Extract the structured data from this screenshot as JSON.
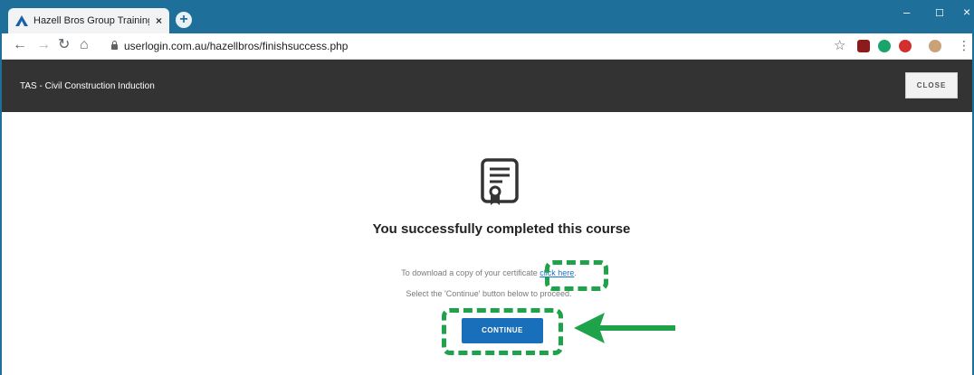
{
  "browser": {
    "tab_title": "Hazell Bros Group Training Platfo",
    "tab_close": "×",
    "new_tab": "+",
    "url": "userlogin.com.au/hazellbros/finishsuccess.php",
    "window_controls": {
      "minimize": "–",
      "maximize": "☐",
      "close": "×"
    },
    "colors": {
      "frame": "#1e6f9a"
    }
  },
  "app": {
    "course_title": "TAS - Civil Construction Induction",
    "close_label": "CLOSE"
  },
  "completion": {
    "heading": "You successfully completed this course",
    "download_prefix": "To download a copy of your certificate ",
    "download_link": "click here",
    "download_suffix": ".",
    "proceed_text": "Select the 'Continue' button below to proceed.",
    "continue_label": "CONTINUE",
    "icon": "certificate-icon"
  },
  "annotations": {
    "highlight_color": "#1fa34a",
    "accent_button": "#1a6fba"
  }
}
